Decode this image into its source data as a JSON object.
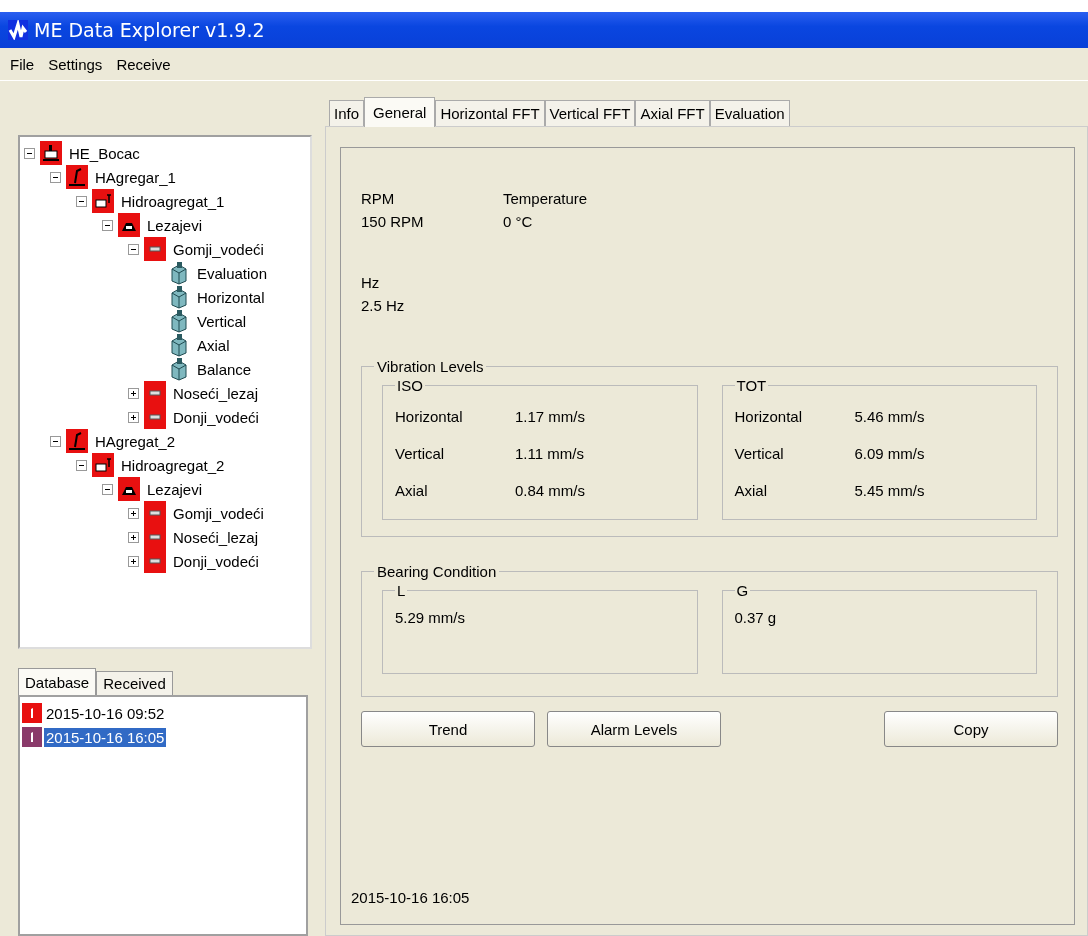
{
  "window": {
    "title": "ME Data Explorer v1.9.2"
  },
  "menu": [
    "File",
    "Settings",
    "Receive"
  ],
  "tree": [
    {
      "label": "HE_Bocac",
      "kind": "plant",
      "expanded": true,
      "children": [
        {
          "label": "HAgregar_1",
          "kind": "unit",
          "expanded": true,
          "children": [
            {
              "label": "Hidroagregat_1",
              "kind": "machine",
              "expanded": true,
              "children": [
                {
                  "label": "Lezajevi",
                  "kind": "bearings",
                  "expanded": true,
                  "children": [
                    {
                      "label": "Gomji_vodeći",
                      "kind": "point",
                      "expanded": true,
                      "children": [
                        {
                          "label": "Evaluation",
                          "kind": "measurement"
                        },
                        {
                          "label": "Horizontal",
                          "kind": "measurement"
                        },
                        {
                          "label": "Vertical",
                          "kind": "measurement"
                        },
                        {
                          "label": "Axial",
                          "kind": "measurement"
                        },
                        {
                          "label": "Balance",
                          "kind": "measurement"
                        }
                      ]
                    },
                    {
                      "label": "Noseći_lezaj",
                      "kind": "point",
                      "expanded": false
                    },
                    {
                      "label": "Donji_vodeći",
                      "kind": "point",
                      "expanded": false
                    }
                  ]
                }
              ]
            }
          ]
        },
        {
          "label": "HAgregat_2",
          "kind": "unit",
          "expanded": true,
          "children": [
            {
              "label": "Hidroagregat_2",
              "kind": "machine",
              "expanded": true,
              "children": [
                {
                  "label": "Lezajevi",
                  "kind": "bearings",
                  "expanded": true,
                  "children": [
                    {
                      "label": "Gomji_vodeći",
                      "kind": "point",
                      "expanded": false
                    },
                    {
                      "label": "Noseći_lezaj",
                      "kind": "point",
                      "expanded": false
                    },
                    {
                      "label": "Donji_vodeći",
                      "kind": "point",
                      "expanded": false
                    }
                  ]
                }
              ]
            }
          ]
        }
      ]
    }
  ],
  "bottom_tabs": [
    {
      "label": "Database",
      "selected": true
    },
    {
      "label": "Received",
      "selected": false
    }
  ],
  "records": [
    {
      "label": "2015-10-16 09:52",
      "selected": false
    },
    {
      "label": "2015-10-16 16:05",
      "selected": true
    }
  ],
  "tabs": [
    {
      "label": "Info",
      "selected": false
    },
    {
      "label": "General",
      "selected": true
    },
    {
      "label": "Horizontal FFT",
      "selected": false
    },
    {
      "label": "Vertical FFT",
      "selected": false
    },
    {
      "label": "Axial FFT",
      "selected": false
    },
    {
      "label": "Evaluation",
      "selected": false
    }
  ],
  "general": {
    "readings": [
      {
        "label": "RPM",
        "value": "150 RPM"
      },
      {
        "label": "Temperature",
        "value": "0 °C"
      }
    ],
    "frequency": {
      "label": "Hz",
      "value": "2.5 Hz"
    },
    "vibration_levels": {
      "title": "Vibration Levels",
      "groups": [
        {
          "title": "ISO",
          "rows": [
            {
              "label": "Horizontal",
              "value": "1.17 mm/s"
            },
            {
              "label": "Vertical",
              "value": "1.11 mm/s"
            },
            {
              "label": "Axial",
              "value": "0.84 mm/s"
            }
          ]
        },
        {
          "title": "TOT",
          "rows": [
            {
              "label": "Horizontal",
              "value": "5.46  mm/s"
            },
            {
              "label": "Vertical",
              "value": "6.09 mm/s"
            },
            {
              "label": "Axial",
              "value": "5.45 mm/s"
            }
          ]
        }
      ]
    },
    "bearing_condition": {
      "title": "Bearing Condition",
      "groups": [
        {
          "title": "L",
          "value": "5.29 mm/s"
        },
        {
          "title": "G",
          "value": "0.37 g"
        }
      ]
    },
    "buttons": [
      "Trend",
      "Alarm Levels",
      "Copy"
    ],
    "timestamp": "2015-10-16 16:05"
  }
}
